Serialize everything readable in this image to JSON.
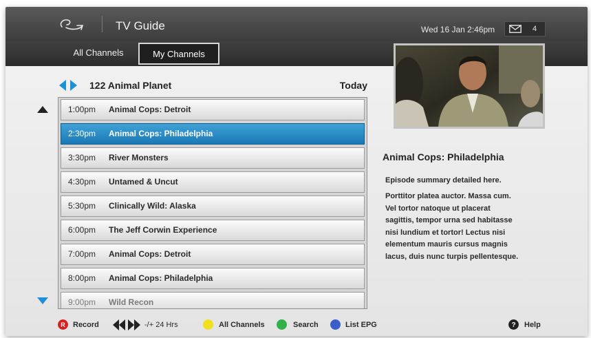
{
  "header": {
    "app_title": "TV Guide",
    "datetime": "Wed 16 Jan 2:46pm",
    "mail_count": "4",
    "logo_icon": "brand-logo-icon",
    "mail_icon": "mail-icon"
  },
  "tabs": [
    {
      "label": "All Channels",
      "selected": false
    },
    {
      "label": "My Channels",
      "selected": true
    }
  ],
  "channel": {
    "name": "122 Animal Planet",
    "day": "Today"
  },
  "schedule": [
    {
      "time": "1:00pm",
      "title": "Animal Cops: Detroit"
    },
    {
      "time": "2:30pm",
      "title": "Animal Cops: Philadelphia",
      "selected": true
    },
    {
      "time": "3:30pm",
      "title": "River Monsters"
    },
    {
      "time": "4:30pm",
      "title": "Untamed & Uncut"
    },
    {
      "time": "5:30pm",
      "title": "Clinically Wild: Alaska"
    },
    {
      "time": "6:00pm",
      "title": "The Jeff Corwin Experience"
    },
    {
      "time": "7:00pm",
      "title": "Animal Cops: Detroit"
    },
    {
      "time": "8:00pm",
      "title": "Animal Cops: Philadelphia"
    },
    {
      "time": "9:00pm",
      "title": "Wild Recon"
    }
  ],
  "details": {
    "title": "Animal Cops: Philadelphia",
    "summary": "Episode summary detailed here.",
    "description_lines": [
      "Porttitor platea auctor. Massa cum.",
      "Vel tortor natoque ut placerat",
      "sagittis, tempor urna sed habitasse",
      "nisi lundium et tortor! Lectus nisi",
      "elementum mauris cursus magnis",
      "lacus, duis nunc turpis pellentesque."
    ]
  },
  "footer": {
    "record_label": "Record",
    "record_key": "R",
    "skip_label": "-/+ 24 Hrs",
    "yellow_label": "All Channels",
    "green_label": "Search",
    "blue_label": "List EPG",
    "help_label": "Help",
    "help_key": "?"
  },
  "colors": {
    "selected_row": "#1f86c2",
    "arrow_blue": "#1e90d6",
    "record_red": "#d42020",
    "yellow": "#f0e020",
    "green": "#2fb24a",
    "blue": "#3a5fc8"
  }
}
